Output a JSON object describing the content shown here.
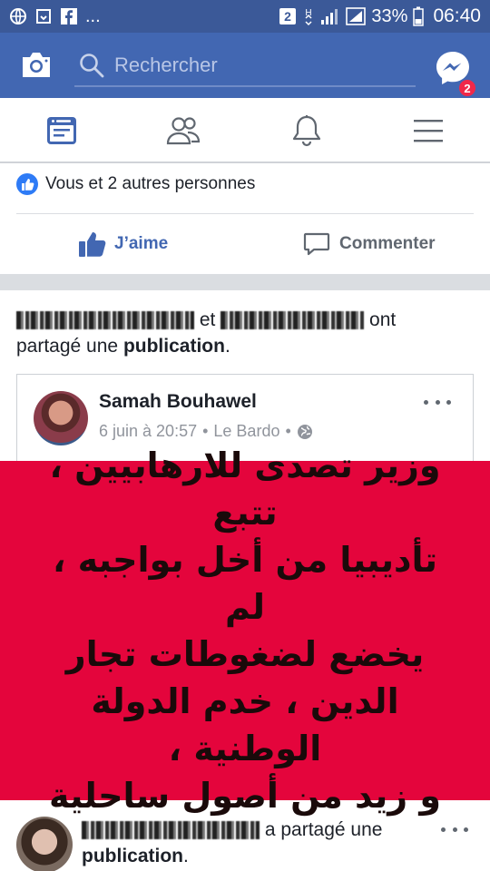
{
  "status_bar": {
    "battery_pct": "33%",
    "time": "06:40",
    "ellipsis": "...",
    "notif_count": "2"
  },
  "header": {
    "search_placeholder": "Rechercher",
    "messenger_badge": "2"
  },
  "tabs": [
    "news-feed-icon",
    "friends-icon",
    "notifications-icon",
    "menu-icon"
  ],
  "post": {
    "likes_text": "Vous et 2 autres personnes",
    "like_label": "J’aime",
    "comment_label": "Commenter"
  },
  "shared": {
    "connector": "et",
    "suffix": "ont",
    "text_part": "partagé une",
    "publication": "publication",
    "period": "."
  },
  "original_post": {
    "author": "Samah Bouhawel",
    "date": "6 juin à 20:57",
    "separator": "•",
    "place": "Le Bardo",
    "separator2": "•",
    "text_lines": [
      "وزير تصدى للارهابيين ، تتبع",
      "تأديبيا من أخل بواجبه ، لم",
      "يخضع لضغوطات تجار",
      "الدين ، خدم الدولة الوطنية ،",
      "و زيد من أصول ساحلية"
    ]
  },
  "next_post": {
    "text_part": "a partagé une",
    "publication": "publication",
    "period": "."
  },
  "colors": {
    "brand_blue": "#4267b2",
    "status_blue": "#3b5998",
    "like_blue": "#2e7bf6",
    "red_background": "#e4053c"
  }
}
